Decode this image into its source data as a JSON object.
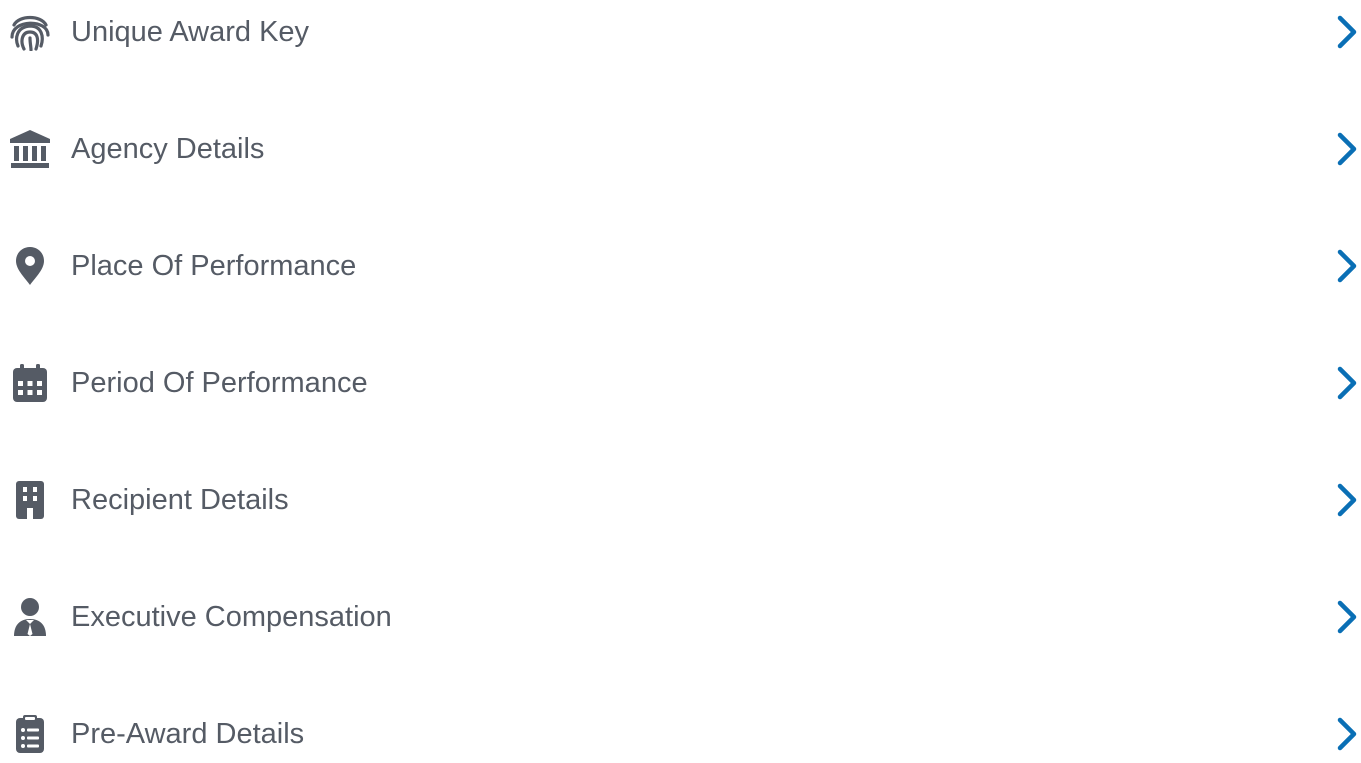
{
  "colors": {
    "icon": "#555b65",
    "label": "#555b65",
    "chevron": "#0a6fb5",
    "background": "#ffffff"
  },
  "menu": {
    "items": [
      {
        "label": "Unique Award Key",
        "icon": "fingerprint-icon"
      },
      {
        "label": "Agency Details",
        "icon": "bank-icon"
      },
      {
        "label": "Place Of Performance",
        "icon": "map-pin-icon"
      },
      {
        "label": "Period Of Performance",
        "icon": "calendar-icon"
      },
      {
        "label": "Recipient Details",
        "icon": "building-icon"
      },
      {
        "label": "Executive Compensation",
        "icon": "user-tie-icon"
      },
      {
        "label": "Pre-Award Details",
        "icon": "clipboard-list-icon"
      }
    ]
  }
}
